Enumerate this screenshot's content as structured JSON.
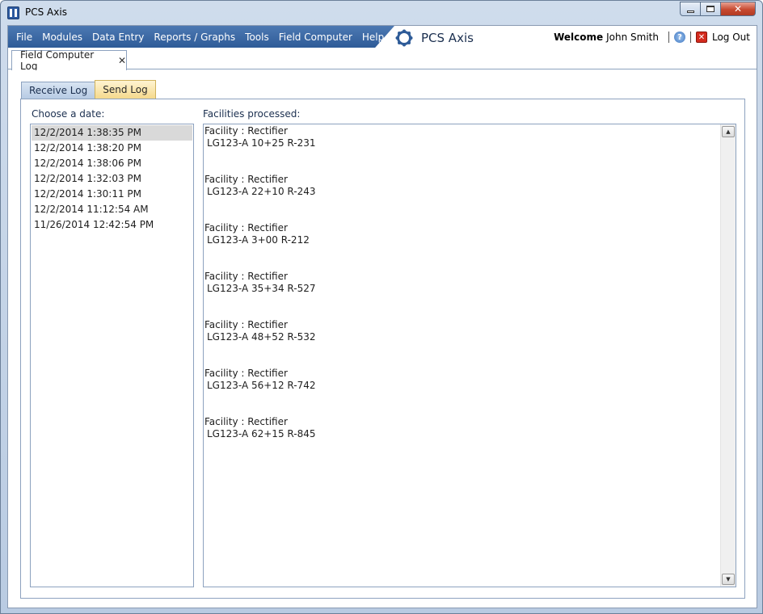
{
  "window": {
    "title": "PCS Axis"
  },
  "menu": {
    "items": [
      "File",
      "Modules",
      "Data Entry",
      "Reports / Graphs",
      "Tools",
      "Field Computer",
      "Help"
    ]
  },
  "header": {
    "logo_text": "PCS Axis",
    "welcome_label": "Welcome",
    "user_name": "John Smith",
    "logout_label": "Log Out"
  },
  "doc_tab": {
    "label": "Field Computer Log",
    "close_glyph": "✕"
  },
  "sub_tabs": {
    "receive_label": "Receive Log",
    "send_label": "Send Log",
    "active": "Send Log"
  },
  "dates": {
    "label": "Choose a date:",
    "selected": "12/2/2014 1:38:35 PM",
    "items": [
      "12/2/2014 1:38:35 PM",
      "12/2/2014 1:38:20 PM",
      "12/2/2014 1:38:06 PM",
      "12/2/2014 1:32:03 PM",
      "12/2/2014 1:30:11 PM",
      "12/2/2014 11:12:54 AM",
      "11/26/2014 12:42:54 PM"
    ]
  },
  "facilities": {
    "label": "Facilities processed:",
    "entries": [
      {
        "type": "Facility : Rectifier",
        "name": "LG123-A 10+25 R-231"
      },
      {
        "type": "Facility : Rectifier",
        "name": "LG123-A 22+10 R-243"
      },
      {
        "type": "Facility : Rectifier",
        "name": "LG123-A 3+00 R-212"
      },
      {
        "type": "Facility : Rectifier",
        "name": "LG123-A 35+34 R-527"
      },
      {
        "type": "Facility : Rectifier",
        "name": "LG123-A 48+52 R-532"
      },
      {
        "type": "Facility : Rectifier",
        "name": "LG123-A 56+12 R-742"
      },
      {
        "type": "Facility : Rectifier",
        "name": "LG123-A 62+15 R-845"
      }
    ]
  },
  "colors": {
    "menu_bar": "#2e5b98",
    "active_tab": "#f5d98c",
    "inactive_tab": "#b7cbe4",
    "selected_row": "#d9d9d9"
  }
}
